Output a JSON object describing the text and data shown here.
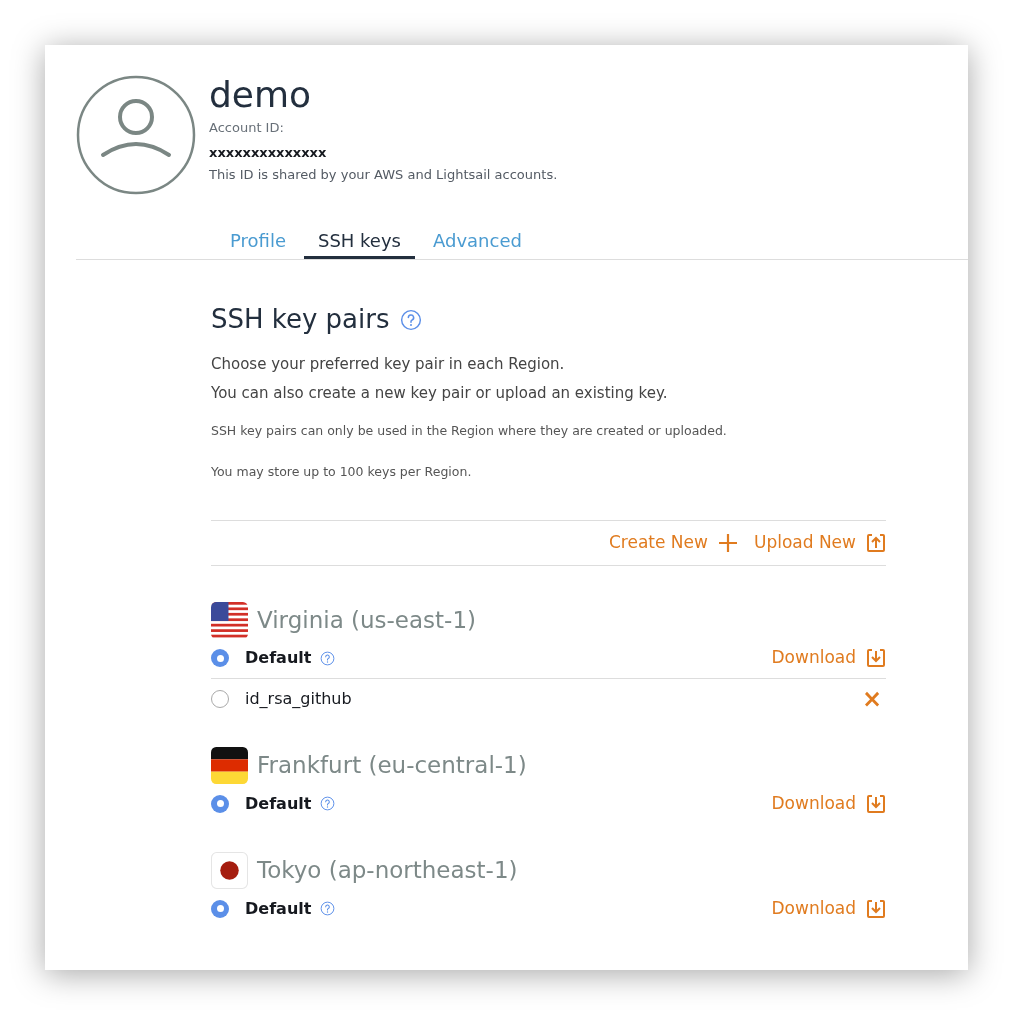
{
  "profile": {
    "name": "demo",
    "account_id_label": "Account ID:",
    "account_id": "xxxxxxxxxxxxxx",
    "note": "This ID is shared by your AWS and Lightsail accounts."
  },
  "tabs": [
    {
      "label": "Profile",
      "selected": false
    },
    {
      "label": "SSH keys",
      "selected": true
    },
    {
      "label": "Advanced",
      "selected": false
    }
  ],
  "section": {
    "title": "SSH key pairs",
    "intro": [
      "Choose your preferred key pair in each Region.",
      "You can also create a new key pair or upload an existing key."
    ],
    "notes": [
      "SSH key pairs can only be used in the Region where they are created or uploaded.",
      "You may store up to 100 keys per Region."
    ]
  },
  "actions": [
    "Create New",
    "Upload New"
  ],
  "regions": [
    {
      "kind": "us",
      "name": "Virginia (us-east-1)",
      "keys": [
        {
          "kind": "default",
          "name": "Default",
          "selected": true,
          "action": "Download"
        },
        {
          "kind": "custom",
          "name": "id_rsa_github",
          "selected": false,
          "action": "×"
        }
      ]
    },
    {
      "kind": "de",
      "name": "Frankfurt (eu-central-1)",
      "keys": [
        {
          "kind": "default",
          "name": "Default",
          "selected": true,
          "action": "Download"
        }
      ]
    },
    {
      "kind": "jp",
      "name": "Tokyo (ap-northeast-1)",
      "keys": [
        {
          "kind": "default",
          "name": "Default",
          "selected": true,
          "action": "Download"
        }
      ]
    }
  ]
}
